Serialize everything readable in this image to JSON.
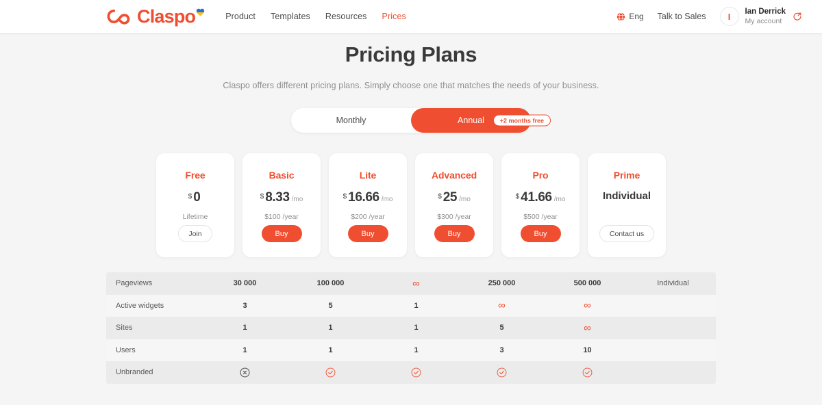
{
  "header": {
    "logo": {
      "text": "Claspo",
      "mark_icon": "cloud-logo-icon",
      "heart_icon": "ukraine-heart-icon"
    },
    "nav": [
      {
        "label": "Product",
        "active": false
      },
      {
        "label": "Templates",
        "active": false
      },
      {
        "label": "Resources",
        "active": false
      },
      {
        "label": "Prices",
        "active": true
      }
    ],
    "language": {
      "icon": "globe-icon",
      "label": "Eng"
    },
    "talk_to_sales": "Talk to Sales",
    "account": {
      "avatar_initial": "I",
      "name": "Ian Derrick",
      "subtitle": "My account",
      "logout_icon": "logout-icon"
    }
  },
  "hero": {
    "title": "Pricing Plans",
    "subtitle": "Claspo offers different pricing plans. Simply choose one that matches the needs of your business."
  },
  "billing_toggle": {
    "options": [
      {
        "label": "Monthly",
        "active": false
      },
      {
        "label": "Annual",
        "active": true
      }
    ],
    "badge": "+2 months free"
  },
  "plans": [
    {
      "name": "Free",
      "currency": "$",
      "amount": "0",
      "per": "",
      "note": "Lifetime",
      "cta": "Join",
      "cta_style": "ghost"
    },
    {
      "name": "Basic",
      "currency": "$",
      "amount": "8.33",
      "per": "/mo",
      "note": "$100 /year",
      "cta": "Buy",
      "cta_style": "filled"
    },
    {
      "name": "Lite",
      "currency": "$",
      "amount": "16.66",
      "per": "/mo",
      "note": "$200 /year",
      "cta": "Buy",
      "cta_style": "filled"
    },
    {
      "name": "Advanced",
      "currency": "$",
      "amount": "25",
      "per": "/mo",
      "note": "$300 /year",
      "cta": "Buy",
      "cta_style": "filled"
    },
    {
      "name": "Pro",
      "currency": "$",
      "amount": "41.66",
      "per": "/mo",
      "note": "$500 /year",
      "cta": "Buy",
      "cta_style": "filled"
    },
    {
      "name": "Prime",
      "price_text": "Individual",
      "cta": "Contact us",
      "cta_style": "ghost"
    }
  ],
  "comparison_table": {
    "rows": [
      {
        "label": "Pageviews",
        "values": [
          "30 000",
          "100 000",
          "∞",
          "250 000",
          "500 000",
          "Individual"
        ]
      },
      {
        "label": "Active widgets",
        "values": [
          "3",
          "5",
          "1",
          "∞",
          "∞",
          ""
        ]
      },
      {
        "label": "Sites",
        "values": [
          "1",
          "1",
          "1",
          "5",
          "∞",
          ""
        ]
      },
      {
        "label": "Users",
        "values": [
          "1",
          "1",
          "1",
          "3",
          "10",
          ""
        ]
      },
      {
        "label": "Unbranded",
        "values": [
          "cross-circle-icon",
          "check-circle-icon",
          "check-circle-icon",
          "check-circle-icon",
          "check-circle-icon",
          ""
        ]
      }
    ]
  },
  "colors": {
    "accent": "#F04E30",
    "page_background": "#F5F5F5",
    "row_dark": "#EBEBEB",
    "row_light": "#F6F6F6",
    "text_dark": "#3A3A3A",
    "text_muted": "#8E8E8E"
  }
}
